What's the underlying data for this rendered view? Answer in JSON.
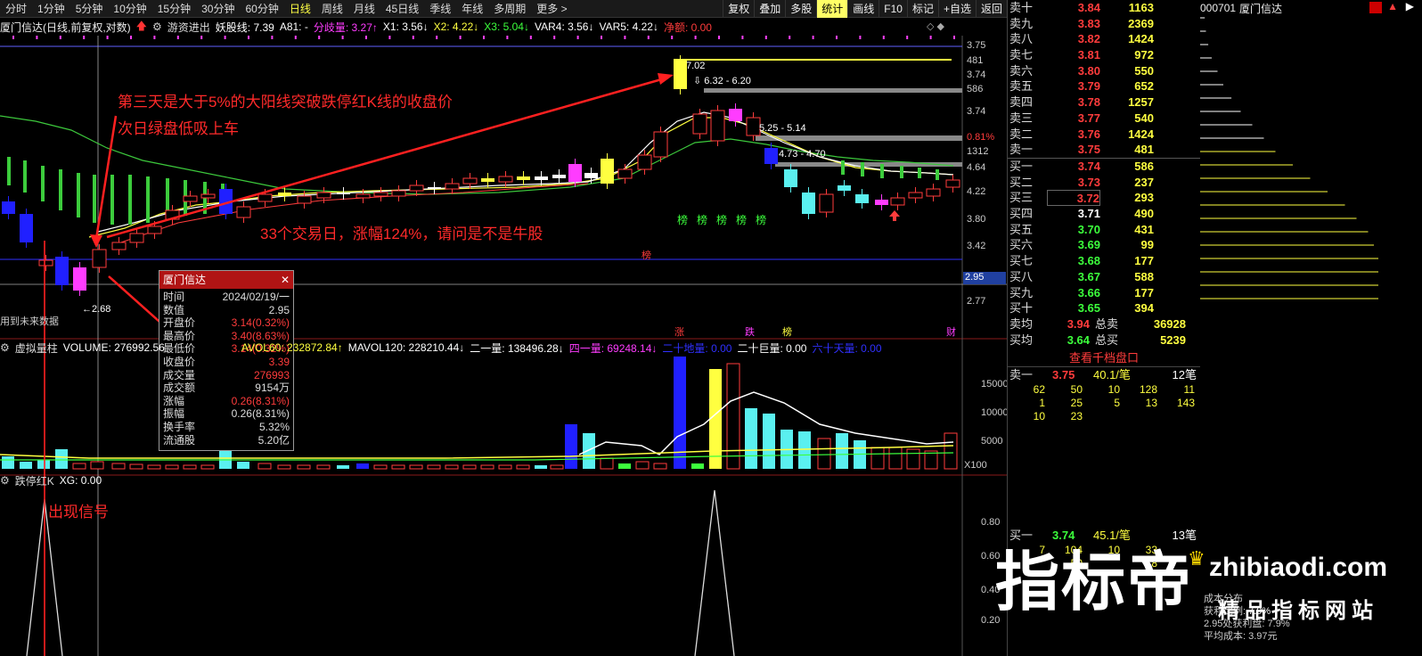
{
  "toolbar": {
    "periods": [
      "分时",
      "1分钟",
      "5分钟",
      "10分钟",
      "15分钟",
      "30分钟",
      "60分钟",
      "日线",
      "周线",
      "月线",
      "45日线",
      "季线",
      "年线",
      "多周期",
      "更多 >"
    ],
    "active_period": "日线",
    "buttons": [
      "复权",
      "叠加",
      "多股",
      "统计",
      "画线",
      "F10",
      "标记",
      "+自选",
      "返回"
    ],
    "active_button": "统计"
  },
  "indicator_line": {
    "stock": "厦门信达(日线,前复权,对数)",
    "name": "游资进出",
    "yaoguxian": "妖股线: 7.39",
    "a81": "A81: -",
    "fenqi": "分歧量: 3.27↑",
    "x1": "X1: 3.56↓",
    "x2": "X2: 4.22↓",
    "x3": "X3: 5.04↓",
    "var4": "VAR4: 3.56↓",
    "var5": "VAR5: 4.22↓",
    "jinge": "净额: 0.00"
  },
  "price_axis": [
    "3.75",
    "481",
    "3.74",
    "586",
    "3.74",
    "0.81%",
    "1312",
    "4.64",
    "4.22",
    "3.80",
    "3.42",
    "2.77"
  ],
  "price_axis_current": "2.95",
  "chart_labels": {
    "high_marker": "7.02",
    "gap1": "6.32 - 6.20",
    "gap2": "5.25 - 5.14",
    "gap3": "4.73 - 4.70",
    "low_marker": "2.68",
    "future_note": "用到未来数据",
    "bang": "榜",
    "zhang": "涨",
    "die": "跌",
    "cai": "财"
  },
  "annotations": {
    "line1": "第三天是大于5%的大阳线突破跌停红K线的收盘价",
    "line2": "次日绿盘低吸上车",
    "stats": "33个交易日，涨幅124%，请问是不是牛股",
    "signal": "出现信号"
  },
  "popup": {
    "title": "厦门信达",
    "rows": [
      {
        "k": "时间",
        "v": "2024/02/19/一",
        "red": false
      },
      {
        "k": "数值",
        "v": "2.95",
        "red": false
      },
      {
        "k": "开盘价",
        "v": "3.14(0.32%)",
        "red": true
      },
      {
        "k": "最高价",
        "v": "3.40(8.63%)",
        "red": true
      },
      {
        "k": "最低价",
        "v": "3.14(0.32%)",
        "red": true
      },
      {
        "k": "收盘价",
        "v": "3.39",
        "red": true
      },
      {
        "k": "成交量",
        "v": "276993",
        "red": true
      },
      {
        "k": "成交额",
        "v": "9154万",
        "red": false
      },
      {
        "k": "涨幅",
        "v": "0.26(8.31%)",
        "red": true
      },
      {
        "k": "振幅",
        "v": "0.26(8.31%)",
        "red": false
      },
      {
        "k": "换手率",
        "v": "5.32%",
        "red": false
      },
      {
        "k": "流通股",
        "v": "5.20亿",
        "red": false
      }
    ]
  },
  "volume_line": {
    "name": "虚拟量柱",
    "volume": "VOLUME: 276992.56",
    "avol60": "AVOL60: 232872.84↑",
    "mavol120": "MAVOL120: 228210.44↓",
    "er": "二一量: 138496.28↓",
    "si": "四一量: 69248.14↓",
    "ershi": "二十地量: 0.00",
    "ershiju": "二十巨量: 0.00",
    "liushi": "六十天量: 0.00"
  },
  "volume_axis": [
    "15000",
    "10000",
    "5000",
    "X100"
  ],
  "bottom_line": {
    "name": "跌停红K",
    "xg": "XG: 0.00"
  },
  "bottom_axis": [
    "0.80",
    "0.60",
    "0.40",
    "0.20"
  ],
  "orderbook": {
    "stock_code": "000701",
    "stock_name": "厦门信达",
    "asks": [
      {
        "label": "卖十",
        "price": "3.84",
        "vol": "1163"
      },
      {
        "label": "卖九",
        "price": "3.83",
        "vol": "2369"
      },
      {
        "label": "卖八",
        "price": "3.82",
        "vol": "1424"
      },
      {
        "label": "卖七",
        "price": "3.81",
        "vol": "972"
      },
      {
        "label": "卖六",
        "price": "3.80",
        "vol": "550"
      },
      {
        "label": "卖五",
        "price": "3.79",
        "vol": "652"
      },
      {
        "label": "卖四",
        "price": "3.78",
        "vol": "1257"
      },
      {
        "label": "卖三",
        "price": "3.77",
        "vol": "540"
      },
      {
        "label": "卖二",
        "price": "3.76",
        "vol": "1424"
      },
      {
        "label": "卖一",
        "price": "3.75",
        "vol": "481"
      }
    ],
    "bids": [
      {
        "label": "买一",
        "price": "3.74",
        "vol": "586"
      },
      {
        "label": "买二",
        "price": "3.73",
        "vol": "237"
      },
      {
        "label": "买三",
        "price": "3.72",
        "vol": "293"
      },
      {
        "label": "买四",
        "price": "3.71",
        "vol": "490"
      },
      {
        "label": "买五",
        "price": "3.70",
        "vol": "431"
      },
      {
        "label": "买六",
        "price": "3.69",
        "vol": "99"
      },
      {
        "label": "买七",
        "price": "3.68",
        "vol": "177"
      },
      {
        "label": "买八",
        "price": "3.67",
        "vol": "588"
      },
      {
        "label": "买九",
        "price": "3.66",
        "vol": "177"
      },
      {
        "label": "买十",
        "price": "3.65",
        "vol": "394"
      }
    ],
    "avg_sell_label": "卖均",
    "avg_sell": "3.94",
    "total_sell_label": "总卖",
    "total_sell": "36928",
    "avg_buy_label": "买均",
    "avg_buy": "3.64",
    "total_buy_label": "总买",
    "total_buy": "5239",
    "view_btn": "查看千档盘口",
    "ask1_label": "卖一",
    "ask1_price": "3.75",
    "ask1_avg": "40.1/笔",
    "ask1_count": "12笔",
    "ask_queue": [
      [
        "62",
        "50",
        "10",
        "128",
        "11"
      ],
      [
        "1",
        "25",
        "5",
        "13",
        "143"
      ],
      [
        "10",
        "23",
        "",
        "",
        ""
      ]
    ],
    "bid1_label": "买一",
    "bid1_price": "3.74",
    "bid1_avg": "45.1/笔",
    "bid1_count": "13笔",
    "bid_queue": [
      [
        "7",
        "104",
        "10",
        "33",
        ""
      ],
      [
        "",
        "50",
        "",
        "18",
        ""
      ]
    ],
    "profit_label": "获利比例:",
    "profit2": "2.95处获利盘: 7.9%",
    "avg_cost": "平均成本: 3.97元",
    "cost_label": "成本分布",
    "cost_pct": "7.9%"
  },
  "watermark": {
    "brand": "指标帝",
    "site": "zhibiaodi.com",
    "slogan": "精品指标网站"
  }
}
